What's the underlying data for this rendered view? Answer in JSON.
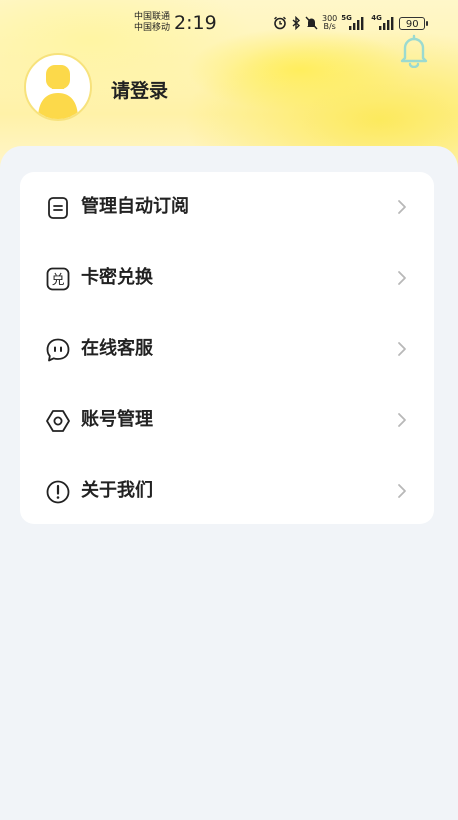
{
  "status_bar": {
    "carrier1": "中国联通",
    "carrier2": "中国移动",
    "time": "2:19",
    "net_speed_value": "300",
    "net_speed_unit": "B/s",
    "net1": "5G",
    "net2": "4G",
    "battery": "90"
  },
  "header": {
    "login_label": "请登录",
    "bell_icon": "bell-icon",
    "avatar_icon": "avatar-placeholder"
  },
  "menu": {
    "items": [
      {
        "label": "管理自动订阅",
        "icon": "subscription-list-icon"
      },
      {
        "label": "卡密兑换",
        "icon": "redeem-icon"
      },
      {
        "label": "在线客服",
        "icon": "chat-bubble-icon"
      },
      {
        "label": "账号管理",
        "icon": "hexagon-settings-icon"
      },
      {
        "label": "关于我们",
        "icon": "info-exclamation-icon"
      }
    ]
  },
  "colors": {
    "accent_yellow": "#fce850",
    "background": "#f1f4f8",
    "card": "#ffffff",
    "text": "#222222",
    "chevron": "#b8b8b8"
  }
}
